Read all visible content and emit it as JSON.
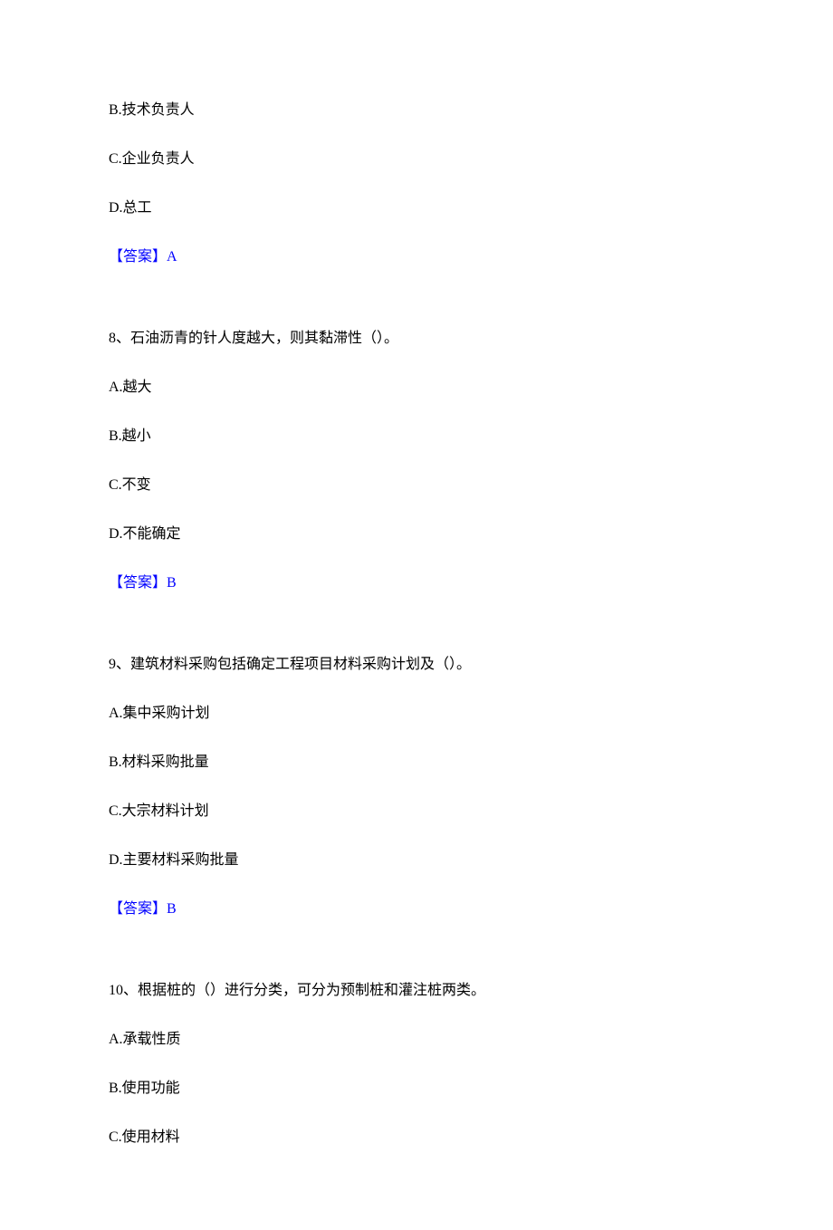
{
  "partial_question_7": {
    "options": [
      "B.技术负责人",
      "C.企业负责人",
      "D.总工"
    ],
    "answer_label": "【答案】",
    "answer_value": "A"
  },
  "questions": [
    {
      "stem": "8、石油沥青的针人度越大，则其黏滞性（）。",
      "options": [
        "A.越大",
        "B.越小",
        "C.不变",
        "D.不能确定"
      ],
      "answer_label": "【答案】",
      "answer_value": "B"
    },
    {
      "stem": "9、建筑材料采购包括确定工程项目材料采购计划及（）。",
      "options": [
        "A.集中采购计划",
        "B.材料采购批量",
        "C.大宗材料计划",
        "D.主要材料采购批量"
      ],
      "answer_label": "【答案】",
      "answer_value": "B"
    },
    {
      "stem": "10、根据桩的（）进行分类，可分为预制桩和灌注桩两类。",
      "options": [
        "A.承载性质",
        "B.使用功能",
        "C.使用材料"
      ],
      "answer_label": "",
      "answer_value": ""
    }
  ]
}
